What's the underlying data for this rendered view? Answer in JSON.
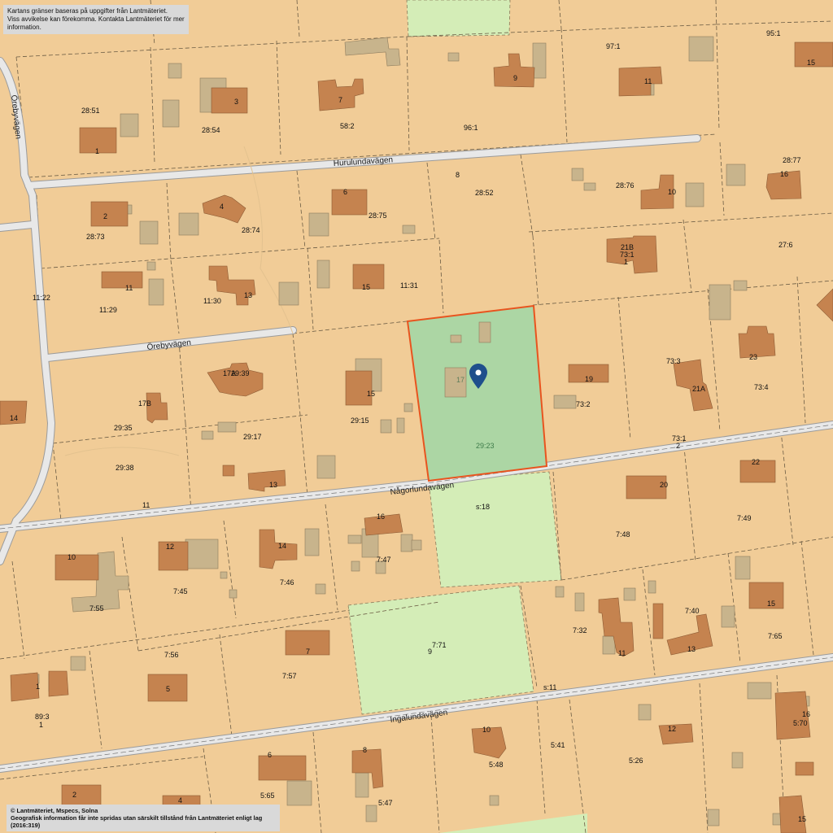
{
  "notices": {
    "top_line1": "Kartans gränser baseras på uppgifter från Lantmäteriet.",
    "top_line2": "Viss avvikelse kan förekomma. Kontakta Lantmäteriet för mer information.",
    "bottom_line1": "© Lantmäteriet, Mspecs, Solna",
    "bottom_line2": "Geografisk information får inte spridas utan särskilt tillstånd från Lantmäteriet enligt lag (2016:319)"
  },
  "roads": {
    "hurulundavagen": "Hurulundavägen",
    "orebyvagen_vertical": "Örebyvägen",
    "orebyvagen": "Örebyvägen",
    "nagorlundavagen": "Någorlundavägen",
    "ingalundavagen": "Ingalundavägen"
  },
  "selected_property": {
    "designation": "29:23",
    "house_number": "17",
    "marker_icon": "location-pin-icon",
    "highlight_color": "#e8541f",
    "fill_color": "#acd6a4"
  },
  "parcel_labels": {
    "p_28_51": "28:51",
    "p_28_54": "28:54",
    "p_58_2": "58:2",
    "p_96_1": "96:1",
    "p_97_1": "97:1",
    "p_95_1": "95:1",
    "p_28_73": "28:73",
    "p_28_74": "28:74",
    "p_28_75": "28:75",
    "p_28_52": "28:52",
    "p_28_76": "28:76",
    "p_28_77": "28:77",
    "p_11_22": "11:22",
    "p_11_29": "11:29",
    "p_11_30": "11:30",
    "p_11_31": "11:31",
    "p_73_1a": "73:1",
    "p_1a": "1",
    "p_27_6": "27:6",
    "p_29_39": "29:39",
    "p_29_15": "29:15",
    "p_73_3": "73:3",
    "p_73_2": "73:2",
    "p_73_4": "73:4",
    "p_29_35": "29:35",
    "p_29_17": "29:17",
    "p_29_38": "29:38",
    "p_73_1b": "73:1",
    "p_2a": "2",
    "p_s18": "s:18",
    "p_7_48": "7:48",
    "p_7_49": "7:49",
    "p_7_47": "7:47",
    "p_7_46": "7:46",
    "p_7_45": "7:45",
    "p_7_55": "7:55",
    "p_7_56": "7:56",
    "p_7_57": "7:57",
    "p_7_71": "7:71",
    "p_9": "9",
    "p_7_32": "7:32",
    "p_7_40": "7:40",
    "p_7_65": "7:65",
    "p_s11": "s:11",
    "p_89_3": "89:3",
    "p_1b": "1",
    "p_5_41": "5:41",
    "p_5_26": "5:26",
    "p_5_70": "5:70",
    "p_5_48": "5:48",
    "p_5_65": "5:65",
    "p_5_47": "5:47",
    "p_8": "8",
    "p_11": "11"
  },
  "house_numbers": {
    "h1": "1",
    "h3": "3",
    "h7a": "7",
    "h9": "9",
    "h11a": "11",
    "h15a": "15",
    "h2a": "2",
    "h4": "4",
    "h6": "6",
    "h10a": "10",
    "h16a": "16",
    "h11b": "11",
    "h13a": "13",
    "h15b": "15",
    "h21b": "21B",
    "h17a": "17A",
    "h15c": "15",
    "h19": "19",
    "h23": "23",
    "h21a": "21A",
    "h14a": "14",
    "h17b": "17B",
    "h13b": "13",
    "h16b": "16",
    "h20": "20",
    "h22": "22",
    "h10b": "10",
    "h12a": "12",
    "h14b": "14",
    "h7b": "7",
    "h5": "5",
    "h1b": "1",
    "h11c": "11",
    "h13c": "13",
    "h15d": "15",
    "h10c": "10",
    "h12b": "12",
    "h16c": "16",
    "h8": "8",
    "h6b": "6",
    "h2b": "2",
    "h4b": "4",
    "h15e": "15"
  }
}
